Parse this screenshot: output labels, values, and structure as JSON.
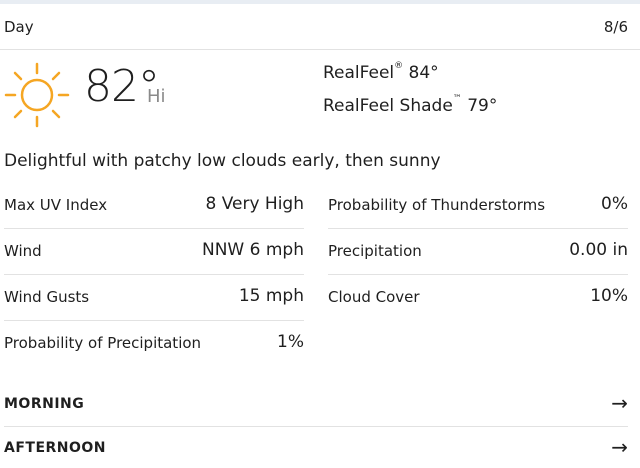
{
  "header": {
    "title": "Day",
    "date": "8/6"
  },
  "current": {
    "icon": "sun-icon",
    "temperature": "82°",
    "hi_label": "Hi",
    "realfeel_label": "RealFeel",
    "realfeel_mark": "®",
    "realfeel_value": "84°",
    "realfeel_shade_label": "RealFeel Shade",
    "realfeel_shade_mark": "™",
    "realfeel_shade_value": "79°",
    "phrase": "Delightful with patchy low clouds early, then sunny"
  },
  "details_left": [
    {
      "label": "Max UV Index",
      "value": "8 Very High"
    },
    {
      "label": "Wind",
      "value": "NNW 6 mph"
    },
    {
      "label": "Wind Gusts",
      "value": "15 mph"
    },
    {
      "label": "Probability of Precipitation",
      "value": "1%"
    }
  ],
  "details_right": [
    {
      "label": "Probability of Thunderstorms",
      "value": "0%"
    },
    {
      "label": "Precipitation",
      "value": "0.00 in"
    },
    {
      "label": "Cloud Cover",
      "value": "10%"
    }
  ],
  "sections": [
    {
      "label": "MORNING",
      "arrow": "→"
    },
    {
      "label": "AFTERNOON",
      "arrow": "→"
    }
  ],
  "colors": {
    "sun": "#f5a623",
    "divider": "#e2e2e2",
    "muted": "#8a8a8a"
  }
}
